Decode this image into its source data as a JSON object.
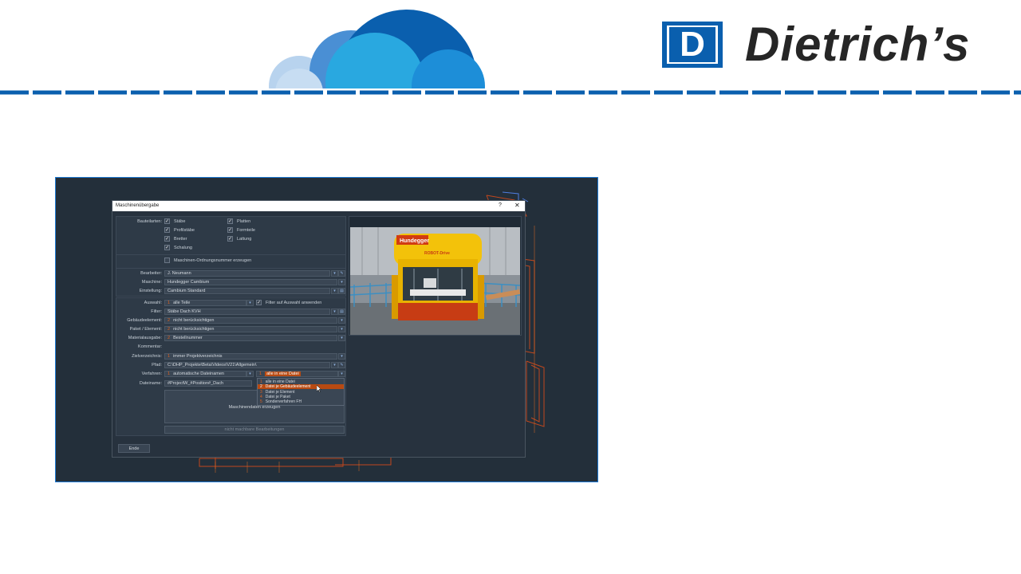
{
  "brand": {
    "logo_letter": "D",
    "name": "Dietrich’s",
    "colors": {
      "primary_blue": "#0a5fae",
      "light_blue": "#29a8e0",
      "pale_blue": "#b8d3ee"
    }
  },
  "dialog": {
    "title": "Maschinenübergabe",
    "help_label": "?",
    "close_label": "✕",
    "bauteilarten": {
      "label": "Bauteilarten:",
      "col1": [
        {
          "label": "Stäbe",
          "checked": true
        },
        {
          "label": "Profilstäbe",
          "checked": true
        },
        {
          "label": "Bretter",
          "checked": true
        },
        {
          "label": "Schalung",
          "checked": true
        }
      ],
      "col2": [
        {
          "label": "Platten",
          "checked": true
        },
        {
          "label": "Formteile",
          "checked": true
        },
        {
          "label": "Lattung",
          "checked": true
        }
      ],
      "ordnungsnummer": {
        "label": "Maschinen-Ordnungsnummer erzeugen",
        "checked": false
      }
    },
    "bearbeiter": {
      "label": "Bearbeiter:",
      "value": "J. Neumann"
    },
    "maschine": {
      "label": "Maschine:",
      "value": "Hundegger Cambium"
    },
    "einstellung": {
      "label": "Einstellung:",
      "value": "Cambium Standard"
    },
    "auswahl": {
      "label": "Auswahl:",
      "num": "1",
      "value": "alle Teile",
      "filter_checkbox_label": "Filter auf Auswahl anwenden",
      "filter_checked": true
    },
    "filter": {
      "label": "Filter:",
      "value": "Stäbe Dach KVH"
    },
    "gebaeudeelement": {
      "label": "Gebäudeelement:",
      "num": "2",
      "value": "nicht berücksichtigen"
    },
    "paket": {
      "label": "Paket / Element:",
      "num": "2",
      "value": "nicht berücksichtigen"
    },
    "materialausgabe": {
      "label": "Materialausgabe:",
      "num": "2",
      "value": "Bestellnummer"
    },
    "kommentar": {
      "label": "Kommentar:",
      "value": ""
    },
    "zielverzeichnis": {
      "label": "Zielverzeichnis:",
      "num": "1",
      "value": "immer Projektverzeichnis"
    },
    "pfad": {
      "label": "Pfad:",
      "value": "C:\\DHP_Projekte\\Beta\\Videos\\V21\\Allgemein\\"
    },
    "verfahren": {
      "label": "Verfahren:",
      "num": "1",
      "value": "automatische Dateinamen",
      "mode_num": "1",
      "mode_value": "alle in eine Datei"
    },
    "dateiname": {
      "label": "Dateiname:",
      "value": "#ProjectW_#Position#_Dach"
    },
    "dropdown_options": [
      {
        "num": "1",
        "label": "alle in eine Datei"
      },
      {
        "num": "2",
        "label": "Datei je Gebäudeelement"
      },
      {
        "num": "3",
        "label": "Datei je Element"
      },
      {
        "num": "4",
        "label": "Datei je Paket"
      },
      {
        "num": "5",
        "label": "Sonderverfahren FH"
      }
    ],
    "dropdown_selected_index": 1,
    "generate_button": "Maschinendaten erzeugen",
    "not_machinable_button": "nicht machbare Bearbeitungen",
    "end_button": "Ende",
    "preview": {
      "machine_brand": "Hundegger",
      "machine_model": "ROBOT-Drive"
    }
  }
}
